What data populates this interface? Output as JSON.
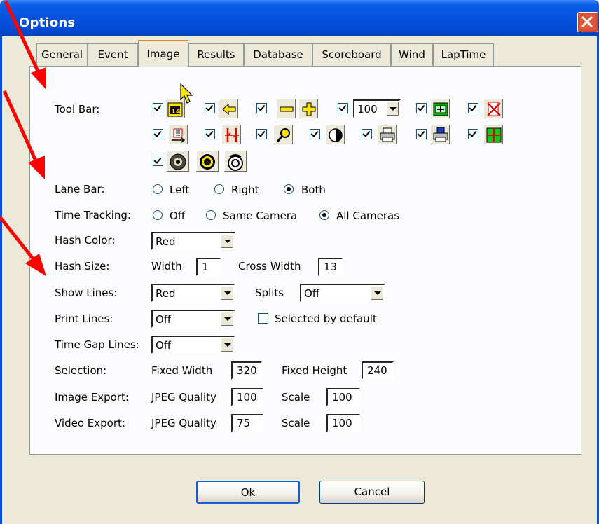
{
  "window": {
    "title": "Options"
  },
  "tabs": [
    "General",
    "Event",
    "Image",
    "Results",
    "Database",
    "Scoreboard",
    "Wind",
    "LapTime"
  ],
  "active_tab": "Image",
  "labels": {
    "tool_bar": "Tool Bar:",
    "lane_bar": "Lane Bar:",
    "time_tracking": "Time Tracking:",
    "hash_color": "Hash Color:",
    "hash_size": "Hash Size:",
    "show_lines": "Show Lines:",
    "print_lines": "Print Lines:",
    "time_gap_lines": "Time Gap Lines:",
    "selection": "Selection:",
    "image_export": "Image Export:",
    "video_export": "Video Export:"
  },
  "toolbar": {
    "zoom_value": "100",
    "icons_row1": [
      "tag-14-icon",
      "arrow-left-icon",
      "minus-icon",
      "plus-icon",
      "zoom-select-icon",
      "green-screen-icon",
      "red-x-icon"
    ],
    "icons_row2": [
      "swap-icon",
      "red-bars-icon",
      "magnifier-icon",
      "contrast-icon",
      "printer-icon",
      "save-print-icon",
      "green-grid-icon"
    ],
    "icons_row3": [
      "circle-dark-icon",
      "circle-yellow-icon",
      "target-icon"
    ]
  },
  "lane_bar": {
    "options": [
      "Left",
      "Right",
      "Both"
    ],
    "selected": "Both"
  },
  "time_tracking": {
    "options": [
      "Off",
      "Same Camera",
      "All Cameras"
    ],
    "selected": "All Cameras"
  },
  "hash_color": "Red",
  "hash_size": {
    "width_label": "Width",
    "width": "1",
    "cross_label": "Cross Width",
    "cross": "13"
  },
  "show_lines": {
    "value": "Red",
    "splits_label": "Splits",
    "splits": "Off"
  },
  "print_lines": {
    "value": "Off",
    "selected_default_label": "Selected by default"
  },
  "time_gap_lines": "Off",
  "selection": {
    "fw_label": "Fixed Width",
    "fw": "320",
    "fh_label": "Fixed Height",
    "fh": "240"
  },
  "image_export": {
    "jpeg_label": "JPEG Quality",
    "jpeg": "100",
    "scale_label": "Scale",
    "scale": "100"
  },
  "video_export": {
    "jpeg_label": "JPEG Quality",
    "jpeg": "75",
    "scale_label": "Scale",
    "scale": "100"
  },
  "buttons": {
    "ok": "Ok",
    "cancel": "Cancel"
  },
  "colors": {
    "title_bar": "#0451dd",
    "annotation_arrow": "#ff0000"
  }
}
